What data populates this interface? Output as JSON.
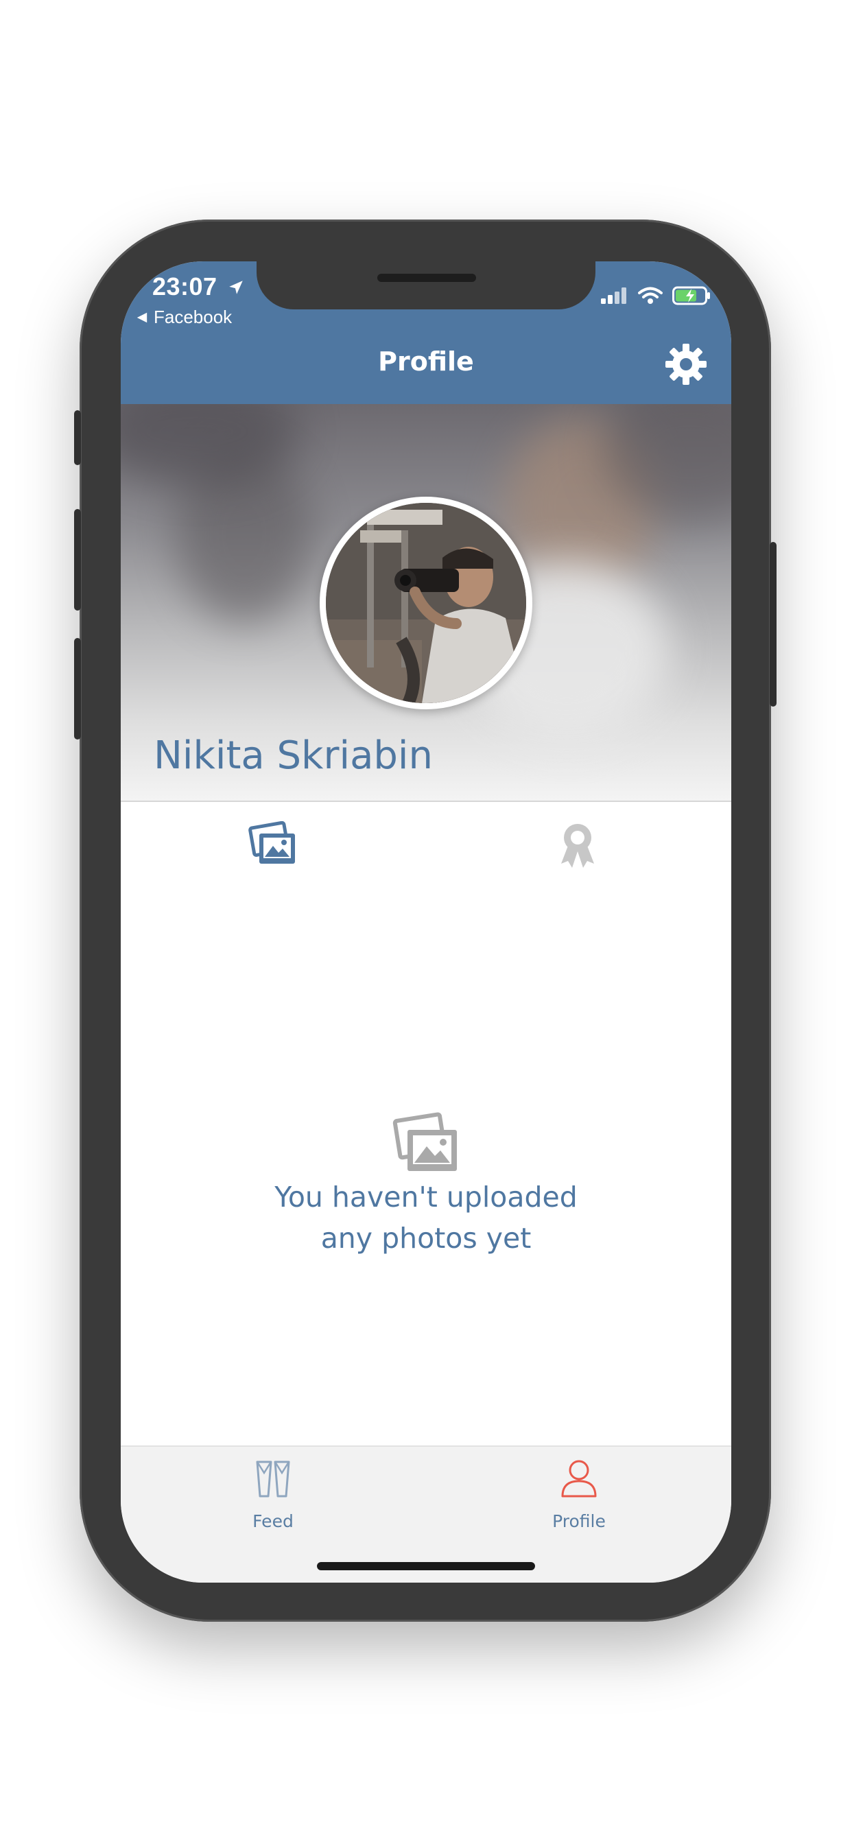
{
  "status_bar": {
    "time": "23:07",
    "back_label": "Facebook"
  },
  "header": {
    "title": "Profile"
  },
  "profile": {
    "name": "Nikita Skriabin"
  },
  "empty_state": {
    "line1": "You haven't uploaded",
    "line2": "any photos yet"
  },
  "tabbar": {
    "items": [
      {
        "label": "Feed",
        "icon": "feed-icon",
        "active": false
      },
      {
        "label": "Profile",
        "icon": "person-icon",
        "active": true
      }
    ]
  },
  "colors": {
    "brand": "#4f77a1",
    "active_tab": "#e8594a",
    "inactive_tab": "#5a7ea3"
  }
}
